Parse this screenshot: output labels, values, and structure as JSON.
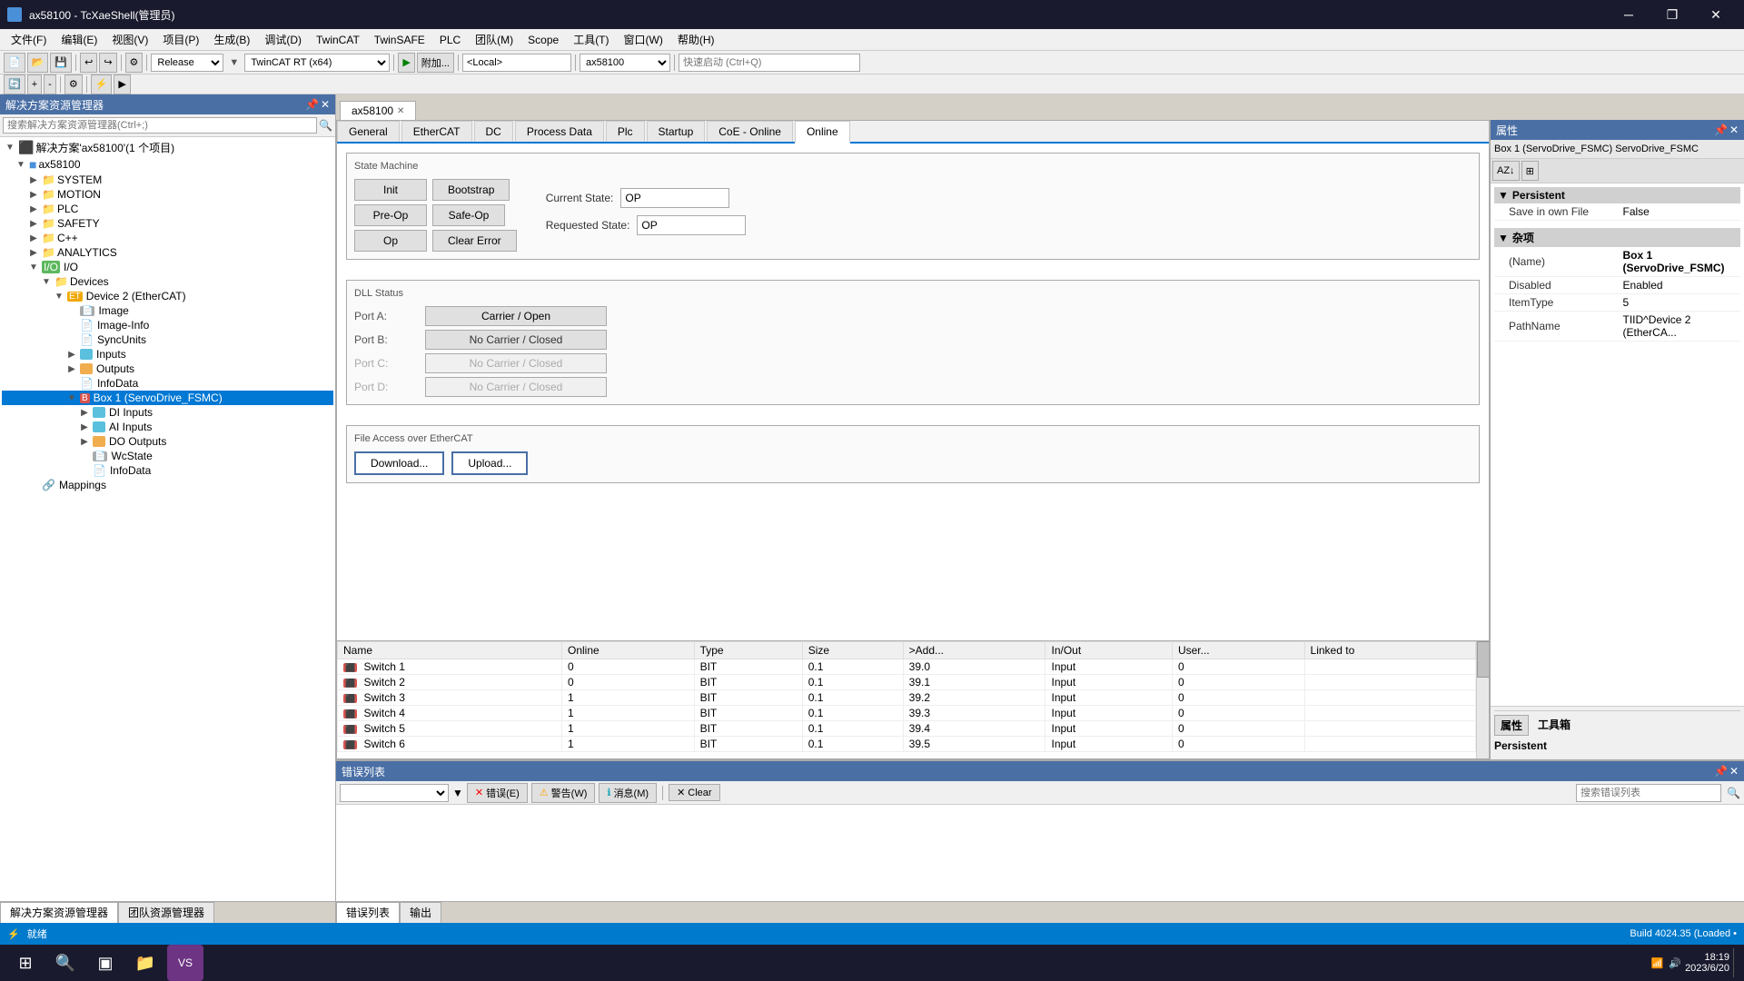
{
  "window": {
    "title": "ax58100 - TcXaeShell(管理员)",
    "close": "✕",
    "minimize": "─",
    "maximize": "□",
    "restore": "❐"
  },
  "menu": {
    "items": [
      "文件(F)",
      "编辑(E)",
      "视图(V)",
      "项目(P)",
      "生成(B)",
      "调试(D)",
      "TwinCAT",
      "TwinSAFE",
      "PLC",
      "团队(M)",
      "Scope",
      "工具(T)",
      "窗口(W)",
      "帮助(H)"
    ]
  },
  "toolbar": {
    "mode_select": "Release",
    "platform_select": "TwinCAT RT (x64)",
    "location_select": "<Local>",
    "project_name": "ax58100",
    "search_placeholder": "快速启动 (Ctrl+Q)"
  },
  "left_panel": {
    "title": "解决方案资源管理器",
    "search_placeholder": "搜索解决方案资源管理器(Ctrl+;)",
    "tree": [
      {
        "label": "解决方案'ax58100'(1 个项目)",
        "level": 0,
        "icon": "solution",
        "expanded": true
      },
      {
        "label": "ax58100",
        "level": 1,
        "icon": "project",
        "expanded": true
      },
      {
        "label": "SYSTEM",
        "level": 2,
        "icon": "folder"
      },
      {
        "label": "MOTION",
        "level": 2,
        "icon": "folder"
      },
      {
        "label": "PLC",
        "level": 2,
        "icon": "folder"
      },
      {
        "label": "SAFETY",
        "level": 2,
        "icon": "folder"
      },
      {
        "label": "C++",
        "level": 2,
        "icon": "folder"
      },
      {
        "label": "ANALYTICS",
        "level": 2,
        "icon": "folder"
      },
      {
        "label": "I/O",
        "level": 2,
        "icon": "io",
        "expanded": true
      },
      {
        "label": "Devices",
        "level": 3,
        "icon": "folder",
        "expanded": true
      },
      {
        "label": "Device 2 (EtherCAT)",
        "level": 4,
        "icon": "device",
        "expanded": true
      },
      {
        "label": "Image",
        "level": 5,
        "icon": "box"
      },
      {
        "label": "Image-Info",
        "level": 5,
        "icon": "box"
      },
      {
        "label": "SyncUnits",
        "level": 5,
        "icon": "box"
      },
      {
        "label": "Inputs",
        "level": 5,
        "icon": "inputs"
      },
      {
        "label": "Outputs",
        "level": 5,
        "icon": "outputs"
      },
      {
        "label": "InfoData",
        "level": 5,
        "icon": "box"
      },
      {
        "label": "Box 1 (ServoDrive_FSMC)",
        "level": 5,
        "icon": "box",
        "selected": true,
        "expanded": true
      },
      {
        "label": "DI Inputs",
        "level": 6,
        "icon": "inputs"
      },
      {
        "label": "AI Inputs",
        "level": 6,
        "icon": "inputs"
      },
      {
        "label": "DO Outputs",
        "level": 6,
        "icon": "outputs"
      },
      {
        "label": "WcState",
        "level": 6,
        "icon": "box"
      },
      {
        "label": "InfoData",
        "level": 6,
        "icon": "box"
      }
    ],
    "mappings": "Mappings"
  },
  "center_tab": {
    "label": "ax58100",
    "active": true
  },
  "inner_tabs": [
    "General",
    "EtherCAT",
    "DC",
    "Process Data",
    "Plc",
    "Startup",
    "CoE - Online",
    "Online"
  ],
  "active_inner_tab": "Online",
  "state_machine": {
    "title": "State Machine",
    "buttons": [
      "Init",
      "Bootstrap",
      "Pre-Op",
      "Safe-Op",
      "Op",
      "Clear Error"
    ],
    "current_state_label": "Current State:",
    "requested_state_label": "Requested State:",
    "current_state_value": "OP",
    "requested_state_value": "OP"
  },
  "dll_status": {
    "title": "DLL Status",
    "ports": [
      {
        "label": "Port A:",
        "value": "Carrier / Open"
      },
      {
        "label": "Port B:",
        "value": "No Carrier / Closed"
      },
      {
        "label": "Port C:",
        "value": "No Carrier / Closed"
      },
      {
        "label": "Port D:",
        "value": "No Carrier / Closed"
      }
    ]
  },
  "file_access": {
    "title": "File Access over EtherCAT",
    "download": "Download...",
    "upload": "Upload..."
  },
  "data_table": {
    "columns": [
      "Name",
      "Online",
      "Type",
      "Size",
      ">Add...",
      "In/Out",
      "User...",
      "Linked to"
    ],
    "rows": [
      {
        "name": "Switch 1",
        "online": "0",
        "type": "BIT",
        "size": "0.1",
        "addr": "39.0",
        "inout": "Input",
        "user": "0",
        "linked": ""
      },
      {
        "name": "Switch 2",
        "online": "0",
        "type": "BIT",
        "size": "0.1",
        "addr": "39.1",
        "inout": "Input",
        "user": "0",
        "linked": ""
      },
      {
        "name": "Switch 3",
        "online": "1",
        "type": "BIT",
        "size": "0.1",
        "addr": "39.2",
        "inout": "Input",
        "user": "0",
        "linked": ""
      },
      {
        "name": "Switch 4",
        "online": "1",
        "type": "BIT",
        "size": "0.1",
        "addr": "39.3",
        "inout": "Input",
        "user": "0",
        "linked": ""
      },
      {
        "name": "Switch 5",
        "online": "1",
        "type": "BIT",
        "size": "0.1",
        "addr": "39.4",
        "inout": "Input",
        "user": "0",
        "linked": ""
      },
      {
        "name": "Switch 6",
        "online": "1",
        "type": "BIT",
        "size": "0.1",
        "addr": "39.5",
        "inout": "Input",
        "user": "0",
        "linked": ""
      }
    ]
  },
  "right_panel": {
    "title": "属性",
    "box_label": "Box 1 (ServoDrive_FSMC) ServoDrive_FSMC",
    "persistent_section": "Persistent",
    "save_in_file_label": "Save in own File",
    "save_in_file_value": "False",
    "misc_section": "杂项",
    "props": [
      {
        "name": "(Name)",
        "value": "Box 1 (ServoDrive_FSMC)"
      },
      {
        "name": "Disabled",
        "value": "Enabled"
      },
      {
        "name": "ItemType",
        "value": "5"
      },
      {
        "name": "PathName",
        "value": "TIID^Device 2 (EtherCA..."
      }
    ],
    "footer": "Persistent"
  },
  "bottom_panel": {
    "title": "错误列表",
    "dropdown_placeholder": "",
    "error_btn": "错误(E)",
    "warning_btn": "警告(W)",
    "message_btn": "消息(M)",
    "clear_btn": "Clear",
    "search_placeholder": "搜索错误列表",
    "tabs": [
      "错误列表",
      "输出"
    ]
  },
  "status_bar": {
    "status": "就绪",
    "build_info": "Build 4024.35 (Loaded •"
  },
  "taskbar": {
    "time": "18:19",
    "date": "2023/6/20"
  }
}
